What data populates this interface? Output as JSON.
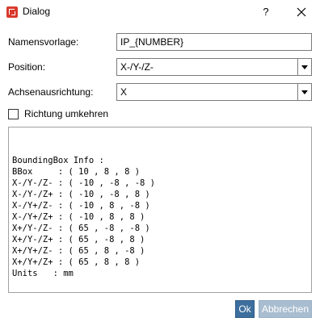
{
  "window": {
    "title": "Dialog",
    "help_label": "?",
    "close_icon": "close-icon",
    "app_icon": "app-logo-icon",
    "app_icon_color": "#d93a2b"
  },
  "form": {
    "name_template_label": "Namensvorlage:",
    "name_template_value": "IP_{NUMBER}",
    "position_label": "Position:",
    "position_value": "X-/Y-/Z-",
    "axis_label": "Achsenausrichtung:",
    "axis_value": "X",
    "reverse_label": "Richtung umkehren",
    "reverse_checked": false
  },
  "info": {
    "lines": [
      "BoundingBox Info :",
      "BBox     : ( 10 , 8 , 8 )",
      "X-/Y-/Z- : ( -10 , -8 , -8 )",
      "X-/Y-/Z+ : ( -10 , -8 , 8 )",
      "X-/Y+/Z- : ( -10 , 8 , -8 )",
      "X-/Y+/Z+ : ( -10 , 8 , 8 )",
      "X+/Y-/Z- : ( 65 , -8 , -8 )",
      "X+/Y-/Z+ : ( 65 , -8 , 8 )",
      "X+/Y+/Z- : ( 65 , 8 , -8 )",
      "X+/Y+/Z+ : ( 65 , 8 , 8 )",
      "Units   : mm"
    ]
  },
  "buttons": {
    "ok_label": "Ok",
    "cancel_label": "Abbrechen",
    "ok_color": "#3d6f9e",
    "cancel_color": "#a9bdd0"
  }
}
